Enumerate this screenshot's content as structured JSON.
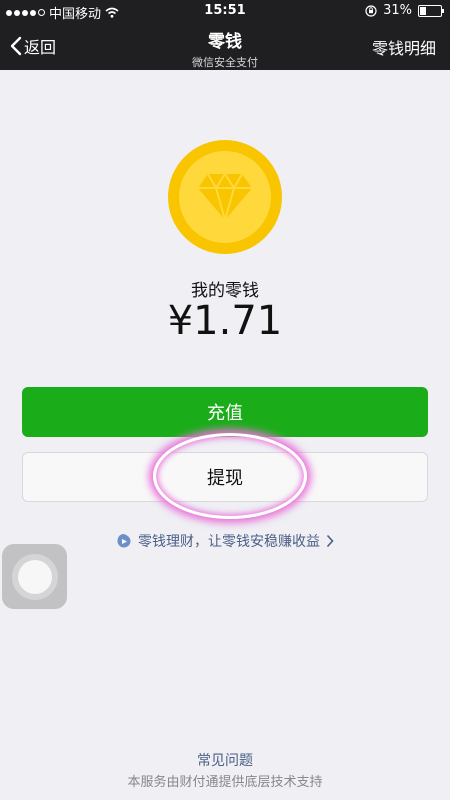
{
  "status_bar": {
    "carrier": "中国移动",
    "time": "15:51",
    "battery": "31%",
    "icons": [
      "signal-dots",
      "wifi-icon",
      "orientation-lock-icon",
      "battery-icon"
    ]
  },
  "nav": {
    "back_label": "返回",
    "title": "零钱",
    "subtitle": "微信安全支付",
    "right_label": "零钱明细"
  },
  "wallet": {
    "coin_icon": "diamond-icon",
    "label": "我的零钱",
    "amount": "¥1.71"
  },
  "actions": {
    "recharge_label": "充值",
    "withdraw_label": "提现"
  },
  "promo": {
    "text": "零钱理财，让零钱安稳赚收益",
    "icon": "wealth-icon"
  },
  "footer": {
    "faq_label": "常见问题",
    "support_text": "本服务由财付通提供底层技术支持"
  },
  "colors": {
    "primary_green": "#1aad19",
    "coin_yellow": "#f9c400",
    "link_blue": "#4b5f87",
    "highlight_pink": "#e872d8"
  }
}
